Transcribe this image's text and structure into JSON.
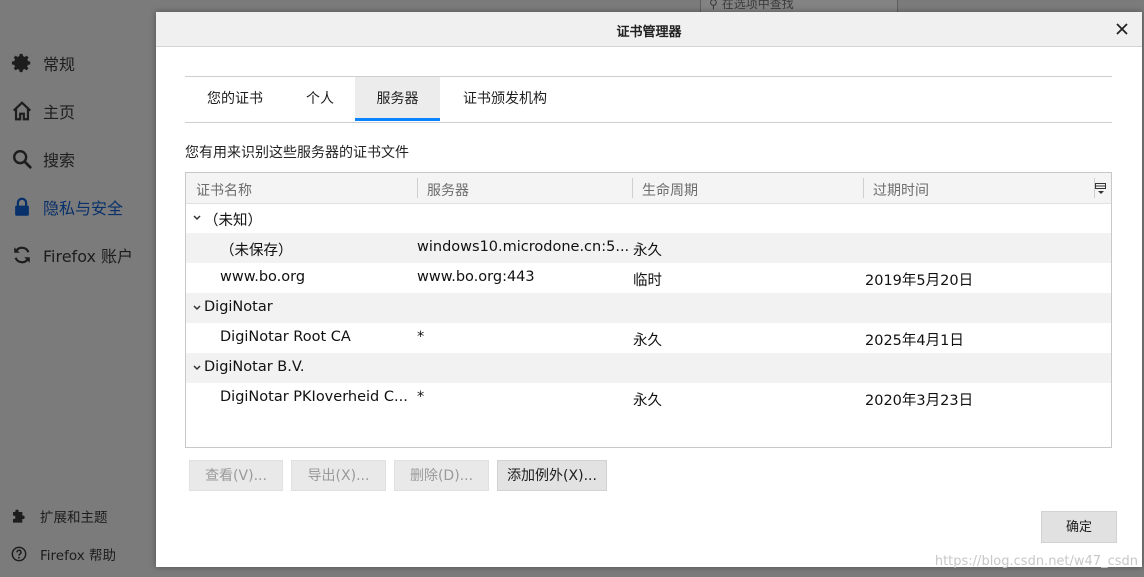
{
  "background": {
    "search_placeholder": "在选项中查找",
    "nav": [
      {
        "label": "常规",
        "icon": "gear-icon"
      },
      {
        "label": "主页",
        "icon": "home-icon"
      },
      {
        "label": "搜索",
        "icon": "search-icon"
      },
      {
        "label": "隐私与安全",
        "icon": "lock-icon"
      },
      {
        "label": "Firefox 账户",
        "icon": "sync-icon"
      }
    ],
    "footer": [
      {
        "label": "扩展和主题",
        "icon": "puzzle-icon"
      },
      {
        "label": "Firefox 帮助",
        "icon": "help-icon"
      }
    ]
  },
  "dialog": {
    "title": "证书管理器",
    "tabs": [
      "您的证书",
      "个人",
      "服务器",
      "证书颁发机构"
    ],
    "selected_tab": "服务器",
    "description": "您有用来识别这些服务器的证书文件",
    "columns": [
      "证书名称",
      "服务器",
      "生命周期",
      "过期时间"
    ],
    "rows": [
      {
        "name": "（未知）",
        "server": "",
        "lifetime": "",
        "expires": ""
      },
      {
        "name": "（未保存）",
        "server": "windows10.microdone.cn:5...",
        "lifetime": "永久",
        "expires": ""
      },
      {
        "name": "www.bo.org",
        "server": "www.bo.org:443",
        "lifetime": "临时",
        "expires": "2019年5月20日"
      },
      {
        "name": "DigiNotar",
        "server": "",
        "lifetime": "",
        "expires": ""
      },
      {
        "name": "DigiNotar Root CA",
        "server": "*",
        "lifetime": "永久",
        "expires": "2025年4月1日"
      },
      {
        "name": "DigiNotar B.V.",
        "server": "",
        "lifetime": "",
        "expires": ""
      },
      {
        "name": "DigiNotar PKIoverheid C...",
        "server": "*",
        "lifetime": "永久",
        "expires": "2020年3月23日"
      }
    ],
    "buttons": {
      "view": "查看(V)...",
      "export": "导出(X)...",
      "delete": "删除(D)...",
      "add_exception": "添加例外(X)...",
      "ok": "确定"
    }
  },
  "watermark": "https://blog.csdn.net/w47_csdn",
  "colors": {
    "accent": "#0a84ff",
    "active_nav": "#08306b"
  }
}
